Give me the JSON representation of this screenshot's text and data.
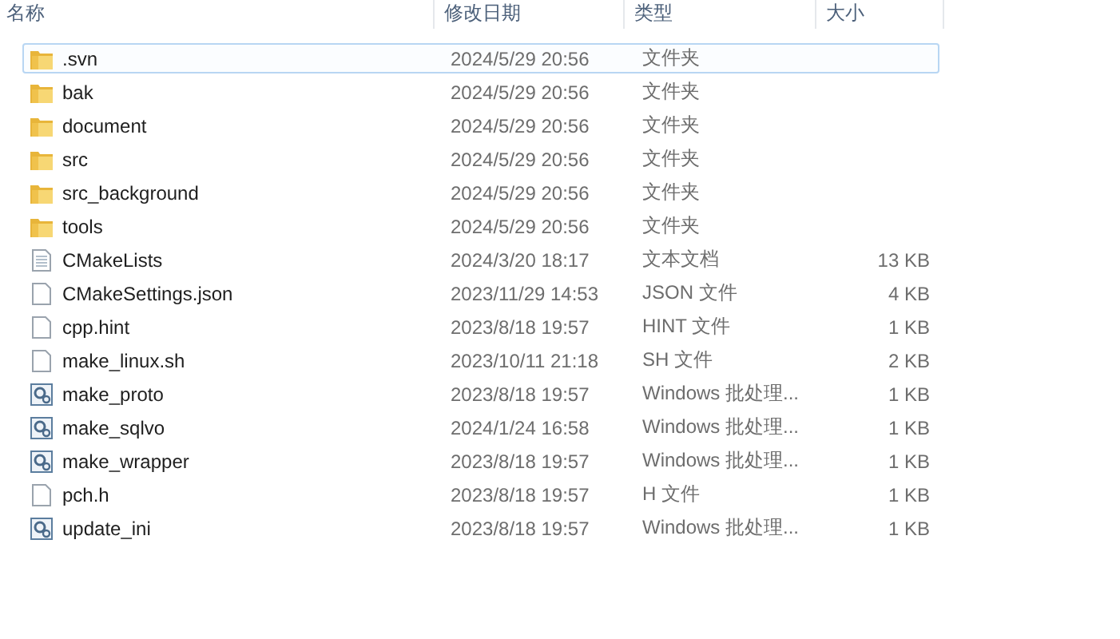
{
  "columns": [
    "名称",
    "修改日期",
    "类型",
    "大小"
  ],
  "rows": [
    {
      "kind": "folder",
      "name": ".svn",
      "date": "2024/5/29 20:56",
      "type": "文件夹",
      "selected": true
    },
    {
      "kind": "folder",
      "name": "bak",
      "date": "2024/5/29 20:56",
      "type": "文件夹",
      "selected": false
    },
    {
      "kind": "folder",
      "name": "document",
      "date": "2024/5/29 20:56",
      "type": "文件夹",
      "selected": false
    },
    {
      "kind": "folder",
      "name": "src",
      "date": "2024/5/29 20:56",
      "type": "文件夹",
      "selected": false
    },
    {
      "kind": "folder",
      "name": "src_background",
      "date": "2024/5/29 20:56",
      "type": "文件夹",
      "selected": false
    },
    {
      "kind": "folder",
      "name": "tools",
      "date": "2024/5/29 20:56",
      "type": "文件夹",
      "selected": false
    },
    {
      "kind": "text",
      "name": "CMakeLists",
      "date": "2024/3/20 18:17",
      "type": "文本文档",
      "size": "13 KB",
      "selected": false
    },
    {
      "kind": "file",
      "name": "CMakeSettings.json",
      "date": "2023/11/29 14:53",
      "type": "JSON 文件",
      "size": "4 KB",
      "selected": false
    },
    {
      "kind": "file",
      "name": "cpp.hint",
      "date": "2023/8/18 19:57",
      "type": "HINT 文件",
      "size": "1 KB",
      "selected": false
    },
    {
      "kind": "file",
      "name": "make_linux.sh",
      "date": "2023/10/11 21:18",
      "type": "SH 文件",
      "size": "2 KB",
      "selected": false
    },
    {
      "kind": "batch",
      "name": "make_proto",
      "date": "2023/8/18 19:57",
      "type": "Windows 批处理...",
      "size": "1 KB",
      "selected": false
    },
    {
      "kind": "batch",
      "name": "make_sqlvo",
      "date": "2024/1/24 16:58",
      "type": "Windows 批处理...",
      "size": "1 KB",
      "selected": false
    },
    {
      "kind": "batch",
      "name": "make_wrapper",
      "date": "2023/8/18 19:57",
      "type": "Windows 批处理...",
      "size": "1 KB",
      "selected": false
    },
    {
      "kind": "file",
      "name": "pch.h",
      "date": "2023/8/18 19:57",
      "type": "H 文件",
      "size": "1 KB",
      "selected": false
    },
    {
      "kind": "batch",
      "name": "update_ini",
      "date": "2023/8/18 19:57",
      "type": "Windows 批处理...",
      "size": "1 KB",
      "selected": false
    }
  ]
}
